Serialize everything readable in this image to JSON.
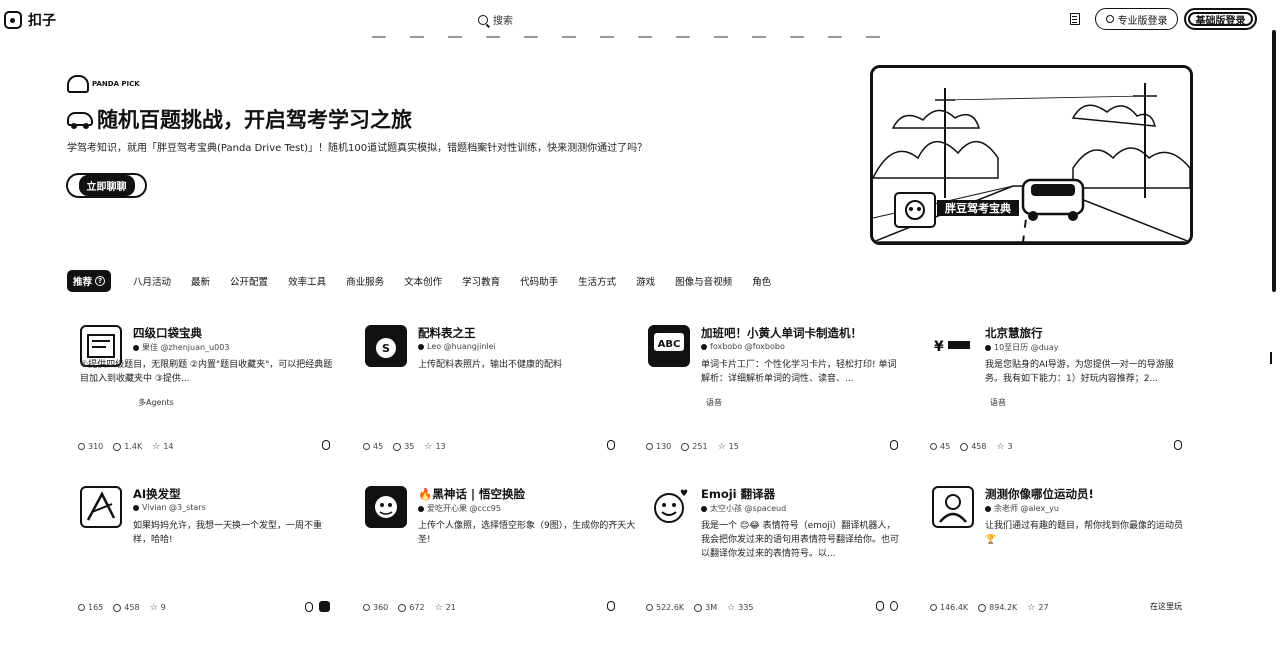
{
  "app": {
    "name": "扣子"
  },
  "header": {
    "search_placeholder": "搜索",
    "pro_login_label": "专业版登录",
    "basic_login_label": "基础版登录"
  },
  "hero": {
    "badge": "PANDA PICK",
    "title": "随机百题挑战，开启驾考学习之旅",
    "description": "学驾考知识，就用「胖豆驾考宝典(Panda Drive Test)」！随机100道试题真实模拟，错题档案针对性训练，快来测测你通过了吗？",
    "cta_label": "立即聊聊",
    "art_caption": "胖豆驾考宝典"
  },
  "tabs": [
    {
      "label": "推荐"
    },
    {
      "label": "八月活动"
    },
    {
      "label": "最新"
    },
    {
      "label": "公开配置"
    },
    {
      "label": "效率工具"
    },
    {
      "label": "商业服务"
    },
    {
      "label": "文本创作"
    },
    {
      "label": "学习教育"
    },
    {
      "label": "代码助手"
    },
    {
      "label": "生活方式"
    },
    {
      "label": "游戏"
    },
    {
      "label": "图像与音视频"
    },
    {
      "label": "角色"
    }
  ],
  "cards": [
    {
      "title": "四级口袋宝典",
      "author": "果佳 @zhenjuan_u003",
      "desc": "①提供四级题目，无限刷题 ②内置\"题目收藏夹\"，可以把经典题目加入到收藏夹中 ③提供...",
      "tag": "多Agents",
      "users": "310",
      "views": "1.4K",
      "stars": "14"
    },
    {
      "title": "配料表之王",
      "author": "Leo @huangjinlei",
      "desc": "上传配料表照片，输出不健康的配料",
      "tag": "",
      "users": "45",
      "views": "35",
      "stars": "13"
    },
    {
      "title": "加班吧！小黄人单词卡制造机！",
      "author": "foxbobo @foxbobo",
      "desc": "单词卡片工厂：个性化学习卡片，轻松打印! 单词解析：详细解析单词的词性、读音、...",
      "tag": "语音",
      "users": "130",
      "views": "251",
      "stars": "15"
    },
    {
      "title": "北京慧旅行",
      "author": "10至日历 @duay",
      "desc": "我是您贴身的AI导游，为您提供一对一的导游服务。我有如下能力：1）好玩内容推荐；2...",
      "tag": "语音",
      "users": "45",
      "views": "458",
      "stars": "3"
    },
    {
      "title": "AI换发型",
      "author": "Vivian @3_stars",
      "desc": "如果妈妈允许，我想一天换一个发型，一周不重样，哈哈!",
      "tag": "",
      "users": "165",
      "views": "458",
      "stars": "9"
    },
    {
      "title": "黑神话 | 悟空换脸",
      "author": "爱吃开心果 @ccc95",
      "desc": "上传个人像照，选择悟空形象（9图），生成你的齐天大圣!",
      "tag": "",
      "users": "360",
      "views": "672",
      "stars": "21"
    },
    {
      "title": "Emoji 翻译器",
      "author": "太空小孩 @spaceud",
      "desc": "我是一个 😊😂 表情符号（emoji）翻译机器人，我会把你发过来的语句用表情符号翻译给你。也可以翻译你发过来的表情符号。以...",
      "tag": "",
      "users": "522.6K",
      "views": "3M",
      "stars": "335"
    },
    {
      "title": "测测你像哪位运动员!",
      "author": "余老师 @alex_yu",
      "desc": "让我们通过有趣的题目，帮你找到你最像的运动员🏆",
      "tag": "",
      "users": "146.4K",
      "views": "894.2K",
      "stars": "27",
      "extra": "在这里玩"
    }
  ]
}
